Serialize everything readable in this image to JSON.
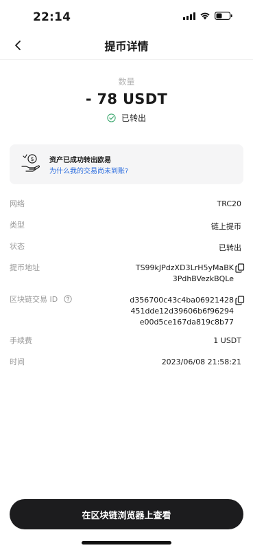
{
  "status_bar": {
    "time": "22:14",
    "icons": [
      "cellular-icon",
      "wifi-icon",
      "battery-icon"
    ]
  },
  "nav": {
    "title": "提币详情",
    "back_icon": "chevron-left-icon"
  },
  "amount": {
    "label": "数量",
    "value": "- 78 USDT",
    "status": "已转出",
    "status_icon": "check-circle-icon"
  },
  "notice_card": {
    "title": "资产已成功转出欧易",
    "link": "为什么我的交易尚未到账?",
    "icon": "coin-hand-icon"
  },
  "details": {
    "network": {
      "label": "网络",
      "value": "TRC20"
    },
    "type": {
      "label": "类型",
      "value": "链上提币"
    },
    "status": {
      "label": "状态",
      "value": "已转出"
    },
    "address": {
      "label": "提币地址",
      "line1": "TS99kJPdzXD3LrH5yMaBK",
      "line2": "3PdhBVezkBQLe"
    },
    "txid": {
      "label": "区块链交易 ID",
      "line1": "d356700c43c4ba06921428",
      "line2": "451dde12d39606b6f96294",
      "line3": "e00d5ce167da819c8b77"
    },
    "fee": {
      "label": "手续费",
      "value": "1 USDT"
    },
    "time": {
      "label": "时间",
      "value": "2023/06/08 21:58:21"
    }
  },
  "actions": {
    "view_explorer": "在区块链浏览器上查看"
  },
  "colors": {
    "accent_link": "#2f6fdf",
    "success": "#3aa76d",
    "button_bg": "#1c1c1e"
  }
}
